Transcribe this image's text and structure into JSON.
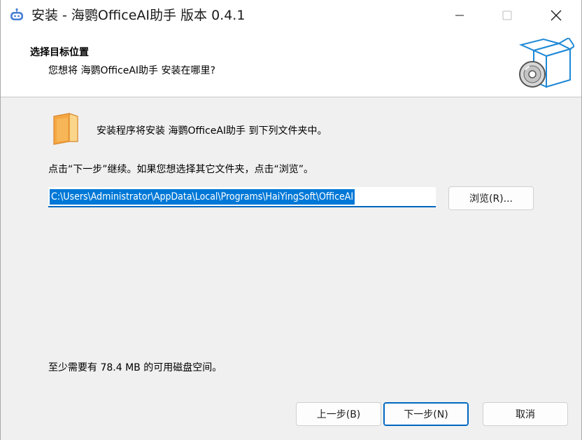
{
  "window": {
    "title": "安装 - 海鹦OfficeAI助手 版本 0.4.1",
    "controls": {
      "minimize": "minimize-icon",
      "maximize": "maximize-icon",
      "close": "close-icon"
    }
  },
  "header": {
    "title": "选择目标位置",
    "subtitle": "您想将 海鹦OfficeAI助手 安装在哪里?"
  },
  "body": {
    "intro": "安装程序将安装 海鹦OfficeAI助手 到下列文件夹中。",
    "instruction": "点击“下一步”继续。如果您想选择其它文件夹，点击“浏览”。",
    "install_path": "C:\\Users\\Administrator\\AppData\\Local\\Programs\\HaiYingSoft\\OfficeAI",
    "browse_label": "浏览(R)...",
    "disk_space": "至少需要有 78.4 MB 的可用磁盘空间。"
  },
  "footer": {
    "back_label": "上一步(B)",
    "next_label": "下一步(N)",
    "cancel_label": "取消"
  },
  "colors": {
    "accent": "#0078d7",
    "folder": "#f5a742"
  }
}
